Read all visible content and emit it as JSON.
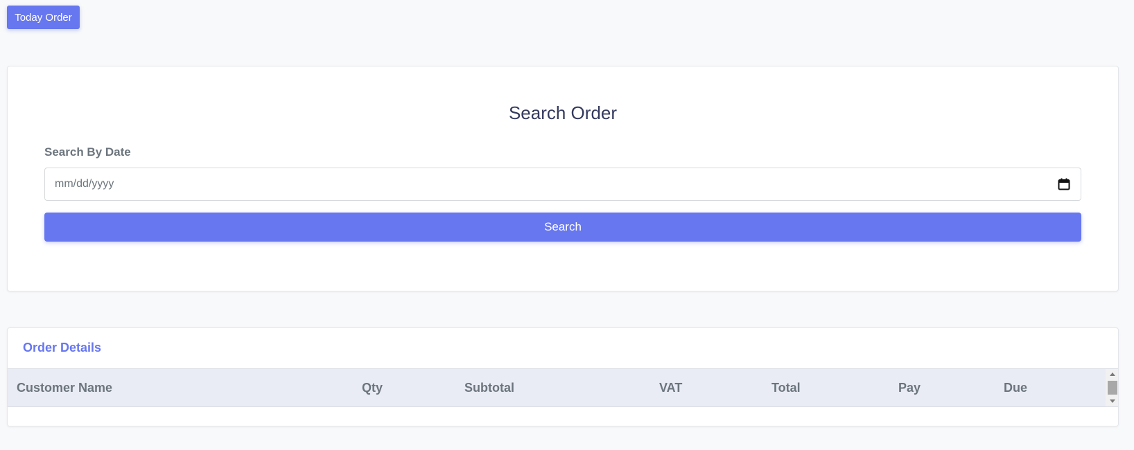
{
  "top": {
    "today_order_label": "Today Order"
  },
  "search": {
    "title": "Search Order",
    "date_label": "Search By Date",
    "date_placeholder": "mm/dd/yyyy",
    "date_icon": "calendar-icon",
    "button_label": "Search"
  },
  "orders": {
    "title": "Order Details",
    "columns": [
      "Customer Name",
      "Qty",
      "Subtotal",
      "VAT",
      "Total",
      "Pay",
      "Due"
    ],
    "rows": []
  },
  "colors": {
    "accent": "#6777ef",
    "page_background": "#f8f9fa",
    "table_header_background": "#e9ecf4",
    "heading_text": "#34395e",
    "muted_text": "#6c757d"
  }
}
